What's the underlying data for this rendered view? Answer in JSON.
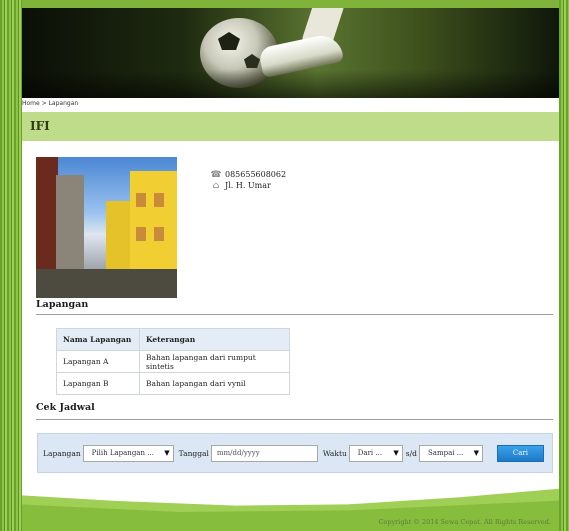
{
  "breadcrumb": {
    "home": "Home",
    "separator": ">",
    "current": "Lapangan"
  },
  "venue": {
    "name": "IFI",
    "phone": "085655608062",
    "address": "Jl. H. Umar"
  },
  "lapangan": {
    "title": "Lapangan",
    "headers": [
      "Nama Lapangan",
      "Keterangan"
    ],
    "rows": [
      {
        "name": "Lapangan A",
        "desc": "Bahan lapangan dari rumput sintetis"
      },
      {
        "name": "Lapangan B",
        "desc": "Bahan lapangan dari vynil"
      }
    ]
  },
  "jadwal": {
    "title": "Cek Jadwal",
    "lapangan_label": "Lapangan",
    "lapangan_select": "Pilih Lapangan ...",
    "tanggal_label": "Tanggal",
    "tanggal_placeholder": "mm/dd/yyyy",
    "waktu_label": "Waktu",
    "dari_select": "Dari ...",
    "sd_label": "s/d",
    "sampai_select": "Sampai ...",
    "cari_button": "Cari"
  },
  "footer": {
    "copyright": "Copyright © 2014 Sewa Cepat. All Rights Reserved."
  },
  "icons": {
    "phone": "phone-icon",
    "address": "home-icon"
  },
  "colors": {
    "title_bar": "#bfdc8a",
    "filter_bg": "#dbe7f4",
    "button": "#2288d6",
    "grass": "#7fb33a"
  }
}
